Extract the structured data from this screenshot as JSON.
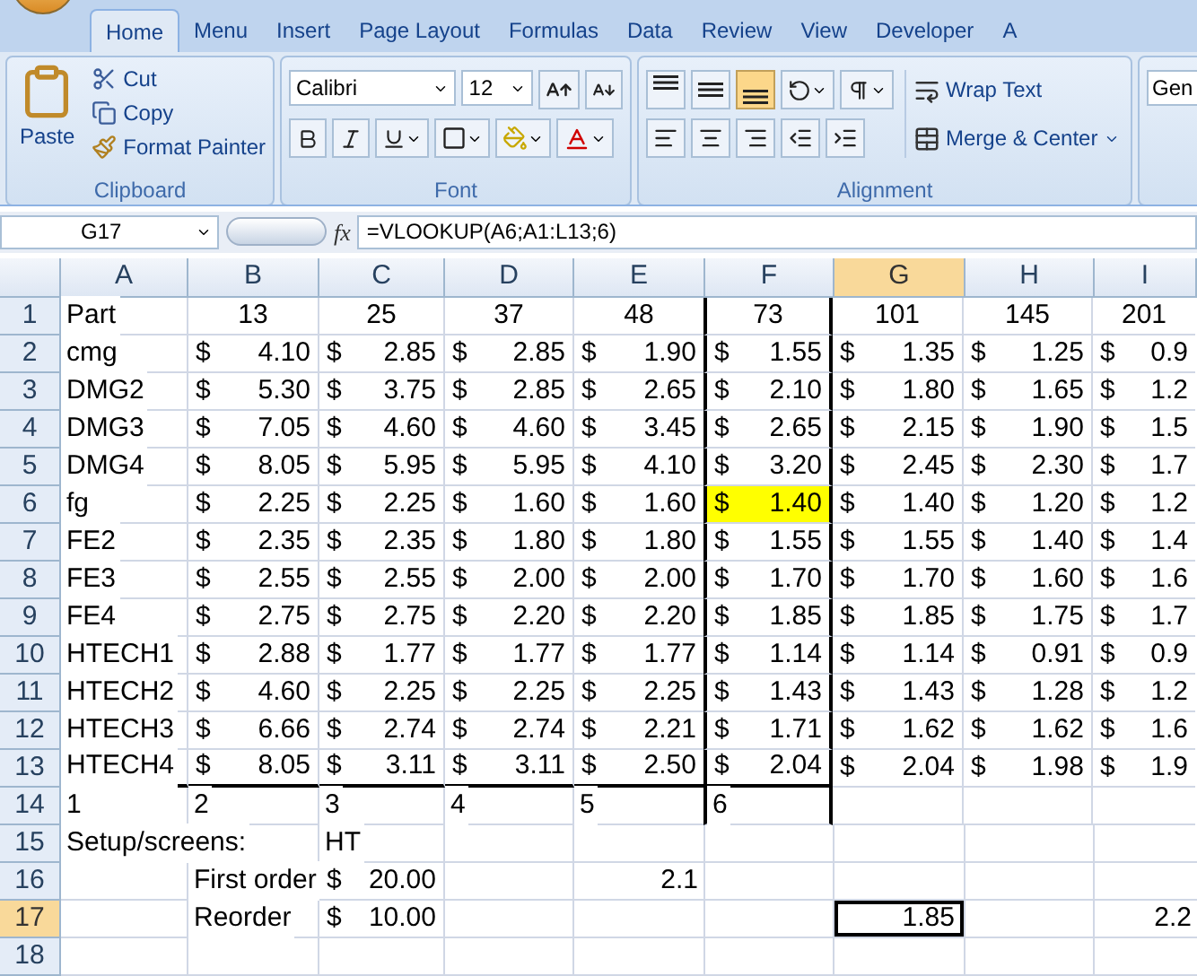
{
  "ribbon": {
    "tabs": [
      {
        "label": "Home",
        "selected": true
      },
      {
        "label": "Menu",
        "selected": false
      },
      {
        "label": "Insert",
        "selected": false
      },
      {
        "label": "Page Layout",
        "selected": false
      },
      {
        "label": "Formulas",
        "selected": false
      },
      {
        "label": "Data",
        "selected": false
      },
      {
        "label": "Review",
        "selected": false
      },
      {
        "label": "View",
        "selected": false
      },
      {
        "label": "Developer",
        "selected": false
      },
      {
        "label": "A",
        "selected": false
      }
    ],
    "groups": [
      {
        "kind": "clipboard",
        "label": "Clipboard",
        "paste": "Paste",
        "cut": "Cut",
        "copy": "Copy",
        "painter": "Format Painter"
      },
      {
        "kind": "font",
        "label": "Font",
        "font_name": "Calibri",
        "font_size": "12"
      },
      {
        "kind": "alignment",
        "label": "Alignment",
        "vertical": [
          {
            "selected": false
          },
          {
            "selected": false
          },
          {
            "selected": true
          }
        ],
        "wrap": "Wrap Text",
        "merge": "Merge & Center"
      },
      {
        "kind": "number",
        "format": "Gen"
      }
    ]
  },
  "formula_bar": {
    "name_box": "G17",
    "fx": "fx",
    "formula": "=VLOOKUP(A6;A1:L13;6)"
  },
  "sheet": {
    "columns": [
      {
        "label": "A",
        "selected": false,
        "boxed": false
      },
      {
        "label": "B",
        "selected": false,
        "boxed": false
      },
      {
        "label": "C",
        "selected": false,
        "boxed": false
      },
      {
        "label": "D",
        "selected": false,
        "boxed": false
      },
      {
        "label": "E",
        "selected": false,
        "boxed": false
      },
      {
        "label": "F",
        "selected": false,
        "boxed": true
      },
      {
        "label": "G",
        "selected": true,
        "boxed": false
      },
      {
        "label": "H",
        "selected": false,
        "boxed": false
      },
      {
        "label": "I",
        "selected": false,
        "boxed": false
      }
    ],
    "rows": [
      {
        "label": "1",
        "selected": false,
        "boxed": true,
        "cells": [
          {
            "kind": "text",
            "value": "Part"
          },
          {
            "kind": "center",
            "value": "13"
          },
          {
            "kind": "center",
            "value": "25"
          },
          {
            "kind": "center",
            "value": "37"
          },
          {
            "kind": "center",
            "value": "48"
          },
          {
            "kind": "center",
            "value": "73"
          },
          {
            "kind": "center",
            "value": "101"
          },
          {
            "kind": "center",
            "value": "145"
          },
          {
            "kind": "center",
            "value": "201"
          }
        ]
      },
      {
        "label": "2",
        "selected": false,
        "boxed": true,
        "cells": [
          {
            "kind": "text",
            "value": "cmg"
          },
          {
            "kind": "money",
            "symbol": "$",
            "amount": "4.10"
          },
          {
            "kind": "money",
            "symbol": "$",
            "amount": "2.85"
          },
          {
            "kind": "money",
            "symbol": "$",
            "amount": "2.85"
          },
          {
            "kind": "money",
            "symbol": "$",
            "amount": "1.90"
          },
          {
            "kind": "money",
            "symbol": "$",
            "amount": "1.55"
          },
          {
            "kind": "money",
            "symbol": "$",
            "amount": "1.35"
          },
          {
            "kind": "money",
            "symbol": "$",
            "amount": "1.25"
          },
          {
            "kind": "money",
            "symbol": "$",
            "amount": "0.9"
          }
        ]
      },
      {
        "label": "3",
        "selected": false,
        "boxed": true,
        "cells": [
          {
            "kind": "text",
            "value": "DMG2"
          },
          {
            "kind": "money",
            "symbol": "$",
            "amount": "5.30"
          },
          {
            "kind": "money",
            "symbol": "$",
            "amount": "3.75"
          },
          {
            "kind": "money",
            "symbol": "$",
            "amount": "2.85"
          },
          {
            "kind": "money",
            "symbol": "$",
            "amount": "2.65"
          },
          {
            "kind": "money",
            "symbol": "$",
            "amount": "2.10"
          },
          {
            "kind": "money",
            "symbol": "$",
            "amount": "1.80"
          },
          {
            "kind": "money",
            "symbol": "$",
            "amount": "1.65"
          },
          {
            "kind": "money",
            "symbol": "$",
            "amount": "1.2"
          }
        ]
      },
      {
        "label": "4",
        "selected": false,
        "boxed": true,
        "cells": [
          {
            "kind": "text",
            "value": "DMG3"
          },
          {
            "kind": "money",
            "symbol": "$",
            "amount": "7.05"
          },
          {
            "kind": "money",
            "symbol": "$",
            "amount": "4.60"
          },
          {
            "kind": "money",
            "symbol": "$",
            "amount": "4.60"
          },
          {
            "kind": "money",
            "symbol": "$",
            "amount": "3.45"
          },
          {
            "kind": "money",
            "symbol": "$",
            "amount": "2.65"
          },
          {
            "kind": "money",
            "symbol": "$",
            "amount": "2.15"
          },
          {
            "kind": "money",
            "symbol": "$",
            "amount": "1.90"
          },
          {
            "kind": "money",
            "symbol": "$",
            "amount": "1.5"
          }
        ]
      },
      {
        "label": "5",
        "selected": false,
        "boxed": true,
        "cells": [
          {
            "kind": "text",
            "value": "DMG4"
          },
          {
            "kind": "money",
            "symbol": "$",
            "amount": "8.05"
          },
          {
            "kind": "money",
            "symbol": "$",
            "amount": "5.95"
          },
          {
            "kind": "money",
            "symbol": "$",
            "amount": "5.95"
          },
          {
            "kind": "money",
            "symbol": "$",
            "amount": "4.10"
          },
          {
            "kind": "money",
            "symbol": "$",
            "amount": "3.20"
          },
          {
            "kind": "money",
            "symbol": "$",
            "amount": "2.45"
          },
          {
            "kind": "money",
            "symbol": "$",
            "amount": "2.30"
          },
          {
            "kind": "money",
            "symbol": "$",
            "amount": "1.7"
          }
        ]
      },
      {
        "label": "6",
        "selected": false,
        "boxed": true,
        "cells": [
          {
            "kind": "text",
            "value": "fg"
          },
          {
            "kind": "money",
            "symbol": "$",
            "amount": "2.25"
          },
          {
            "kind": "money",
            "symbol": "$",
            "amount": "2.25"
          },
          {
            "kind": "money",
            "symbol": "$",
            "amount": "1.60"
          },
          {
            "kind": "money",
            "symbol": "$",
            "amount": "1.60"
          },
          {
            "kind": "money",
            "symbol": "$",
            "amount": "1.40",
            "color": "#ffff00"
          },
          {
            "kind": "money",
            "symbol": "$",
            "amount": "1.40"
          },
          {
            "kind": "money",
            "symbol": "$",
            "amount": "1.20"
          },
          {
            "kind": "money",
            "symbol": "$",
            "amount": "1.2"
          }
        ]
      },
      {
        "label": "7",
        "selected": false,
        "boxed": true,
        "cells": [
          {
            "kind": "text",
            "value": "FE2"
          },
          {
            "kind": "money",
            "symbol": "$",
            "amount": "2.35"
          },
          {
            "kind": "money",
            "symbol": "$",
            "amount": "2.35"
          },
          {
            "kind": "money",
            "symbol": "$",
            "amount": "1.80"
          },
          {
            "kind": "money",
            "symbol": "$",
            "amount": "1.80"
          },
          {
            "kind": "money",
            "symbol": "$",
            "amount": "1.55"
          },
          {
            "kind": "money",
            "symbol": "$",
            "amount": "1.55"
          },
          {
            "kind": "money",
            "symbol": "$",
            "amount": "1.40"
          },
          {
            "kind": "money",
            "symbol": "$",
            "amount": "1.4"
          }
        ]
      },
      {
        "label": "8",
        "selected": false,
        "boxed": true,
        "cells": [
          {
            "kind": "text",
            "value": "FE3"
          },
          {
            "kind": "money",
            "symbol": "$",
            "amount": "2.55"
          },
          {
            "kind": "money",
            "symbol": "$",
            "amount": "2.55"
          },
          {
            "kind": "money",
            "symbol": "$",
            "amount": "2.00"
          },
          {
            "kind": "money",
            "symbol": "$",
            "amount": "2.00"
          },
          {
            "kind": "money",
            "symbol": "$",
            "amount": "1.70"
          },
          {
            "kind": "money",
            "symbol": "$",
            "amount": "1.70"
          },
          {
            "kind": "money",
            "symbol": "$",
            "amount": "1.60"
          },
          {
            "kind": "money",
            "symbol": "$",
            "amount": "1.6"
          }
        ]
      },
      {
        "label": "9",
        "selected": false,
        "boxed": true,
        "cells": [
          {
            "kind": "text",
            "value": "FE4"
          },
          {
            "kind": "money",
            "symbol": "$",
            "amount": "2.75"
          },
          {
            "kind": "money",
            "symbol": "$",
            "amount": "2.75"
          },
          {
            "kind": "money",
            "symbol": "$",
            "amount": "2.20"
          },
          {
            "kind": "money",
            "symbol": "$",
            "amount": "2.20"
          },
          {
            "kind": "money",
            "symbol": "$",
            "amount": "1.85"
          },
          {
            "kind": "money",
            "symbol": "$",
            "amount": "1.85"
          },
          {
            "kind": "money",
            "symbol": "$",
            "amount": "1.75"
          },
          {
            "kind": "money",
            "symbol": "$",
            "amount": "1.7"
          }
        ]
      },
      {
        "label": "10",
        "selected": false,
        "boxed": true,
        "cells": [
          {
            "kind": "text",
            "value": "HTECH1"
          },
          {
            "kind": "money",
            "symbol": "$",
            "amount": "2.88"
          },
          {
            "kind": "money",
            "symbol": "$",
            "amount": "1.77"
          },
          {
            "kind": "money",
            "symbol": "$",
            "amount": "1.77"
          },
          {
            "kind": "money",
            "symbol": "$",
            "amount": "1.77"
          },
          {
            "kind": "money",
            "symbol": "$",
            "amount": "1.14"
          },
          {
            "kind": "money",
            "symbol": "$",
            "amount": "1.14"
          },
          {
            "kind": "money",
            "symbol": "$",
            "amount": "0.91"
          },
          {
            "kind": "money",
            "symbol": "$",
            "amount": "0.9"
          }
        ]
      },
      {
        "label": "11",
        "selected": false,
        "boxed": true,
        "cells": [
          {
            "kind": "text",
            "value": "HTECH2"
          },
          {
            "kind": "money",
            "symbol": "$",
            "amount": "4.60"
          },
          {
            "kind": "money",
            "symbol": "$",
            "amount": "2.25"
          },
          {
            "kind": "money",
            "symbol": "$",
            "amount": "2.25"
          },
          {
            "kind": "money",
            "symbol": "$",
            "amount": "2.25"
          },
          {
            "kind": "money",
            "symbol": "$",
            "amount": "1.43"
          },
          {
            "kind": "money",
            "symbol": "$",
            "amount": "1.43"
          },
          {
            "kind": "money",
            "symbol": "$",
            "amount": "1.28"
          },
          {
            "kind": "money",
            "symbol": "$",
            "amount": "1.2"
          }
        ]
      },
      {
        "label": "12",
        "selected": false,
        "boxed": true,
        "cells": [
          {
            "kind": "text",
            "value": "HTECH3"
          },
          {
            "kind": "money",
            "symbol": "$",
            "amount": "6.66"
          },
          {
            "kind": "money",
            "symbol": "$",
            "amount": "2.74"
          },
          {
            "kind": "money",
            "symbol": "$",
            "amount": "2.74"
          },
          {
            "kind": "money",
            "symbol": "$",
            "amount": "2.21"
          },
          {
            "kind": "money",
            "symbol": "$",
            "amount": "1.71"
          },
          {
            "kind": "money",
            "symbol": "$",
            "amount": "1.62"
          },
          {
            "kind": "money",
            "symbol": "$",
            "amount": "1.62"
          },
          {
            "kind": "money",
            "symbol": "$",
            "amount": "1.6"
          }
        ]
      },
      {
        "label": "13",
        "selected": false,
        "boxed": true,
        "rule_below": true,
        "cells": [
          {
            "kind": "text",
            "value": "HTECH4"
          },
          {
            "kind": "money",
            "symbol": "$",
            "amount": "8.05"
          },
          {
            "kind": "money",
            "symbol": "$",
            "amount": "3.11"
          },
          {
            "kind": "money",
            "symbol": "$",
            "amount": "3.11"
          },
          {
            "kind": "money",
            "symbol": "$",
            "amount": "2.50"
          },
          {
            "kind": "money",
            "symbol": "$",
            "amount": "2.04"
          },
          {
            "kind": "money",
            "symbol": "$",
            "amount": "2.04"
          },
          {
            "kind": "money",
            "symbol": "$",
            "amount": "1.98"
          },
          {
            "kind": "money",
            "symbol": "$",
            "amount": "1.9"
          }
        ]
      },
      {
        "label": "14",
        "selected": false,
        "boxed": true,
        "cells": [
          {
            "kind": "text",
            "value": "1"
          },
          {
            "kind": "text",
            "value": "2"
          },
          {
            "kind": "text",
            "value": "3"
          },
          {
            "kind": "text",
            "value": "4"
          },
          {
            "kind": "text",
            "value": "5"
          },
          {
            "kind": "text",
            "value": "6"
          },
          null,
          null,
          null
        ]
      },
      {
        "label": "15",
        "selected": false,
        "boxed": false,
        "cells": [
          {
            "kind": "text",
            "value": "Setup/screens:"
          },
          null,
          {
            "kind": "text",
            "value": "HT"
          },
          null,
          null,
          null,
          null,
          null,
          null
        ]
      },
      {
        "label": "16",
        "selected": false,
        "boxed": false,
        "cells": [
          null,
          {
            "kind": "text",
            "value": "First order"
          },
          {
            "kind": "money",
            "symbol": "$",
            "amount": "20.00"
          },
          null,
          {
            "kind": "number",
            "value": "2.1"
          },
          null,
          null,
          null,
          null
        ]
      },
      {
        "label": "17",
        "selected": true,
        "boxed": false,
        "cells": [
          null,
          {
            "kind": "text",
            "value": "Reorder"
          },
          {
            "kind": "money",
            "symbol": "$",
            "amount": "10.00"
          },
          null,
          null,
          null,
          {
            "kind": "number",
            "value": "1.85"
          },
          null,
          {
            "kind": "number",
            "value": "2.2"
          }
        ]
      },
      {
        "label": "18",
        "selected": false,
        "boxed": false,
        "cells": [
          null,
          null,
          null,
          null,
          null,
          null,
          null,
          null,
          null
        ]
      }
    ]
  }
}
